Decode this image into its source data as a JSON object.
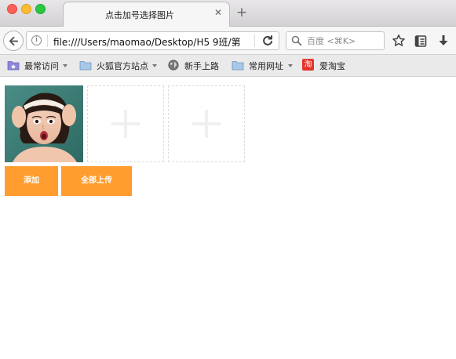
{
  "window": {
    "controls": [
      "close",
      "minimize",
      "zoom"
    ]
  },
  "tab": {
    "title": "点击加号选择图片",
    "close_icon": "close-icon",
    "new_tab_icon": "plus-icon"
  },
  "navbar": {
    "back_icon": "back-arrow-icon",
    "url": "file:///Users/maomao/Desktop/H5 9班/第",
    "reload_icon": "reload-icon",
    "search": {
      "placeholder": "百度 <⌘K>",
      "value": ""
    },
    "toolbar_icons": [
      "star-icon",
      "reader-list-icon",
      "download-icon"
    ]
  },
  "bookmarks": [
    {
      "label": "最常访问",
      "icon": "smart-folder-icon",
      "dropdown": true
    },
    {
      "label": "火狐官方站点",
      "icon": "folder-icon",
      "dropdown": true
    },
    {
      "label": "新手上路",
      "icon": "globe-icon",
      "dropdown": false
    },
    {
      "label": "常用网址",
      "icon": "folder-icon",
      "dropdown": true
    },
    {
      "label": "爱淘宝",
      "icon": "taobao-icon",
      "dropdown": false
    }
  ],
  "page": {
    "taobao_badge": "淘",
    "upload_slots": 2,
    "buttons": {
      "add": "添加",
      "upload_all": "全部上传"
    },
    "colors": {
      "button": "#ff9d2e",
      "button_text": "#ffffff",
      "slot_border": "#dcdcdc",
      "plus": "#f0f0f0"
    }
  }
}
